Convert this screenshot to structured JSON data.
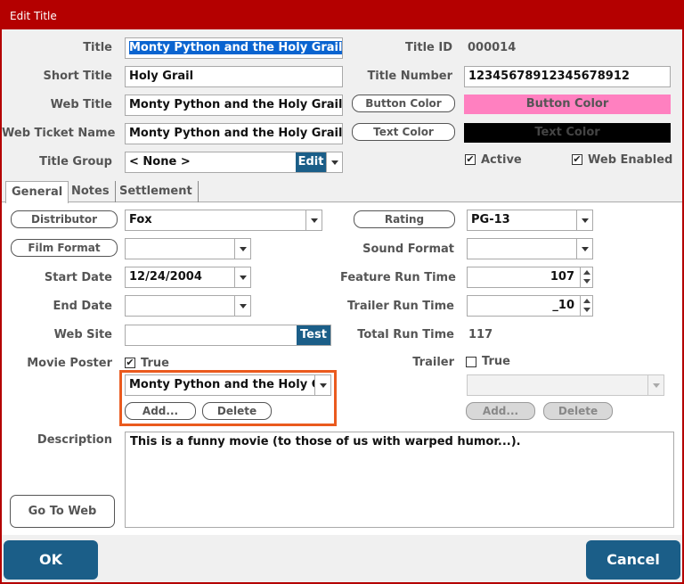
{
  "window": {
    "title": "Edit Title"
  },
  "header": {
    "title_label": "Title",
    "title_value": "Monty Python and the Holy Grail",
    "short_title_label": "Short Title",
    "short_title_value": "Holy Grail",
    "web_title_label": "Web Title",
    "web_title_value": "Monty Python and the Holy Grail",
    "web_ticket_name_label": "Web Ticket Name",
    "web_ticket_name_value": "Monty Python and the Holy Grail",
    "title_group_label": "Title Group",
    "title_group_value": "< None >",
    "edit_label": "Edit",
    "title_id_label": "Title ID",
    "title_id_value": "000014",
    "title_number_label": "Title Number",
    "title_number_value": "12345678912345678912",
    "button_color_label": "Button Color",
    "button_color_swatch_text": "Button Color",
    "button_color_hex": "#ff80c0",
    "text_color_label": "Text Color",
    "text_color_swatch_text": "Text Color",
    "text_color_hex": "#000000",
    "active_label": "Active",
    "active_checked": true,
    "web_enabled_label": "Web Enabled",
    "web_enabled_checked": true
  },
  "tabs": [
    {
      "label": "General",
      "active": true
    },
    {
      "label": "Notes",
      "active": false
    },
    {
      "label": "Settlement",
      "active": false
    }
  ],
  "general": {
    "distributor_label": "Distributor",
    "distributor_value": "Fox",
    "rating_label": "Rating",
    "rating_value": "PG-13",
    "film_format_label": "Film Format",
    "film_format_value": "",
    "sound_format_label": "Sound Format",
    "sound_format_value": "",
    "start_date_label": "Start Date",
    "start_date_value": "12/24/2004",
    "end_date_label": "End Date",
    "end_date_value": "",
    "feature_run_time_label": "Feature Run Time",
    "feature_run_time_value": "107",
    "trailer_run_time_label": "Trailer Run Time",
    "trailer_run_time_value": "_10",
    "web_site_label": "Web Site",
    "web_site_value": "",
    "test_label": "Test",
    "total_run_time_label": "Total Run Time",
    "total_run_time_value": "117",
    "movie_poster_label": "Movie Poster",
    "movie_poster_true_label": "True",
    "movie_poster_checked": true,
    "movie_poster_value": "Monty Python and the Holy Gr",
    "add_label": "Add...",
    "delete_label": "Delete",
    "trailer_label": "Trailer",
    "trailer_true_label": "True",
    "trailer_checked": false,
    "trailer_value": "",
    "trailer_add_label": "Add...",
    "trailer_delete_label": "Delete",
    "description_label": "Description",
    "description_value": "This is a funny movie (to those of us with warped humor...).",
    "go_to_web_label": "Go To Web"
  },
  "footer": {
    "ok_label": "OK",
    "cancel_label": "Cancel"
  },
  "colors": {
    "accent": "#1b5e88",
    "titlebar": "#b40000",
    "highlight": "#ea5a1e"
  }
}
